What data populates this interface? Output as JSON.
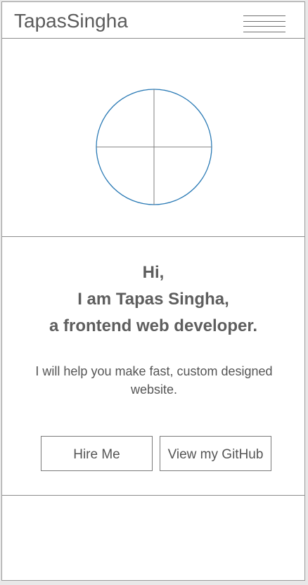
{
  "header": {
    "brand": "TapasSingha",
    "menu_icon": "hamburger-menu-icon"
  },
  "hero": {
    "avatar_icon": "placeholder-circle-icon",
    "colors": {
      "circle": "#2a7ab5",
      "cross": "#808080"
    }
  },
  "intro": {
    "greeting_line1": "Hi,",
    "greeting_line2": "I am Tapas Singha,",
    "greeting_line3": "a frontend web developer.",
    "tagline": "I will help you make fast, custom designed website."
  },
  "actions": {
    "hire_label": "Hire Me",
    "github_label": "View my GitHub"
  }
}
